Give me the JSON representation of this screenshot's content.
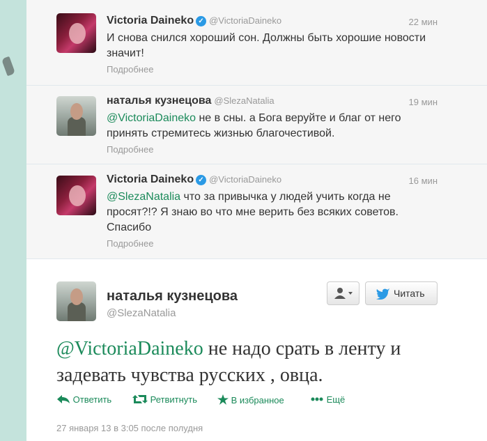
{
  "tweets": [
    {
      "name": "Victoria Daineko",
      "handle": "@VictoriaDaineko",
      "time": "22 мин",
      "mention": "",
      "text": "И снова снился хороший сон. Должны быть хорошие новости значит!",
      "more": "Подробнее",
      "verified": true
    },
    {
      "name": "наталья кузнецова",
      "handle": "@SlezaNatalia",
      "time": "19 мин",
      "mention": "@VictoriaDaineko",
      "text": " не в сны. а Бога веруйте и благ от него принять стремитесь жизнью благочестивой.",
      "more": "Подробнее",
      "verified": false
    },
    {
      "name": "Victoria Daineko",
      "handle": "@VictoriaDaineko",
      "time": "16 мин",
      "mention": "@SlezaNatalia",
      "text": " что за привычка у людей учить когда не просят?!? Я знаю во что мне верить без всяких советов. Спасибо",
      "more": "Подробнее",
      "verified": true
    }
  ],
  "main": {
    "name": "наталья кузнецова",
    "handle": "@SlezaNatalia",
    "mention": "@VictoriaDaineko",
    "text": " не надо срать в ленту и задевать чувства русских , овца.",
    "follow_label": "Читать",
    "actions": {
      "reply": "Ответить",
      "retweet": "Ретвитнуть",
      "favorite": "В избранное",
      "more": "Ещё"
    },
    "date": "27 января 13 в 3:05 после полудня"
  },
  "colors": {
    "accent": "#1b8a5a",
    "verified": "#2b9ae5",
    "background": "#c4e3dc"
  },
  "icons": [
    "verified-icon",
    "user-icon",
    "chevron-down-icon",
    "twitter-bird-icon",
    "reply-icon",
    "retweet-icon",
    "star-icon",
    "dots-icon"
  ]
}
